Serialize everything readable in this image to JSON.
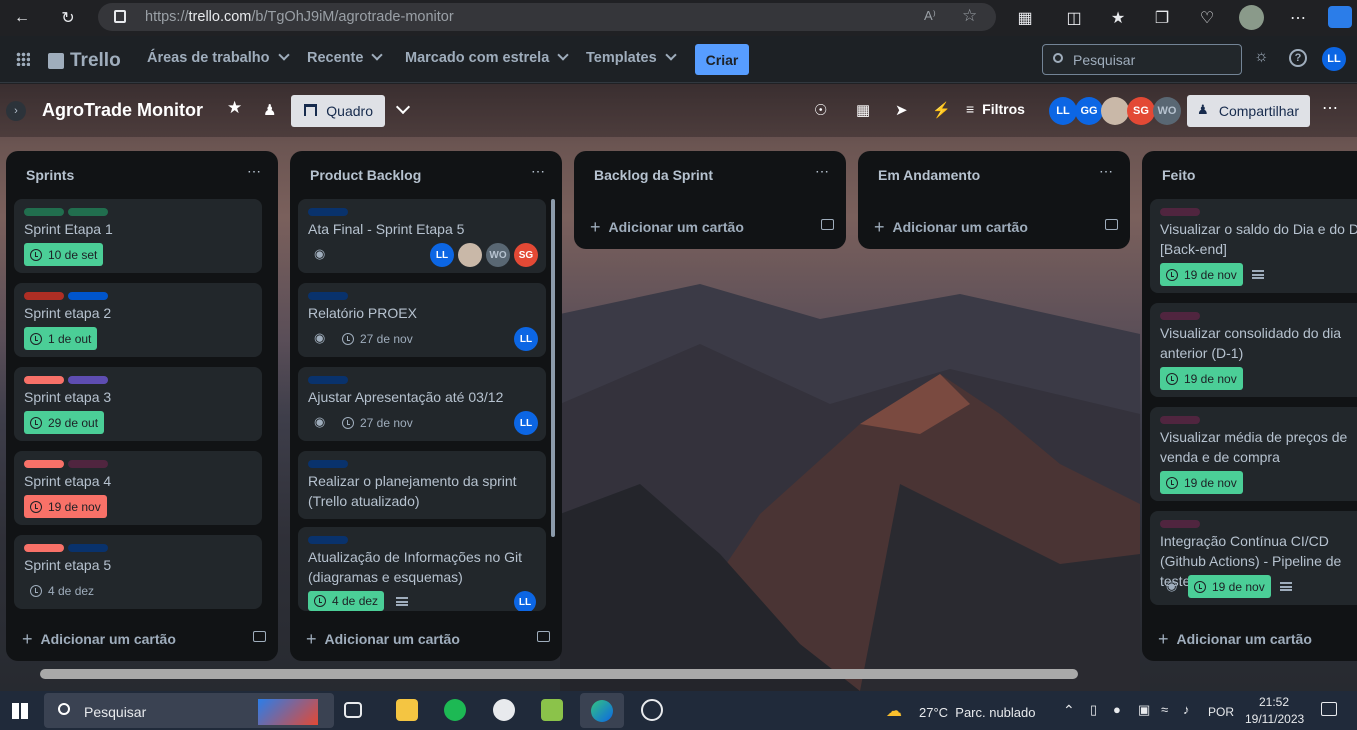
{
  "browser": {
    "url_prefix": "https://",
    "url_domain": "trello.com",
    "url_path": "/b/TgOhJ9iM/agrotrade-monitor"
  },
  "topnav": {
    "logo": "Trello",
    "items": [
      "Áreas de trabalho",
      "Recente",
      "Marcado com estrela",
      "Templates"
    ],
    "create": "Criar",
    "search_placeholder": "Pesquisar",
    "user": "LL"
  },
  "board": {
    "title": "AgroTrade Monitor",
    "view": "Quadro",
    "filters": "Filtros",
    "share": "Compartilhar",
    "members": [
      "LL",
      "GG",
      "SG",
      "WO"
    ]
  },
  "lists": [
    {
      "title": "Sprints",
      "add": "Adicionar um cartão",
      "cards": [
        {
          "title": "Sprint Etapa 1",
          "labels": [
            "#216e4e",
            "#216e4e"
          ],
          "due": "10 de set",
          "due_status": "done"
        },
        {
          "title": "Sprint etapa 2",
          "labels": [
            "#ae2e24",
            "#0055cc"
          ],
          "due": "1 de out",
          "due_status": "done"
        },
        {
          "title": "Sprint etapa 3",
          "labels": [
            "#f87168",
            "#5e4db2"
          ],
          "due": "29 de out",
          "due_status": "done"
        },
        {
          "title": "Sprint etapa 4",
          "labels": [
            "#f87168",
            "#50253f"
          ],
          "due": "19 de nov",
          "due_status": "overdue"
        },
        {
          "title": "Sprint etapa 5",
          "labels": [
            "#f87168",
            "#09326c"
          ],
          "due": "4 de dez",
          "due_status": "none"
        }
      ]
    },
    {
      "title": "Product Backlog",
      "add": "Adicionar um cartão",
      "cards": [
        {
          "title": "Ata Final - Sprint Etapa 5",
          "members": [
            "LL",
            "",
            "WO",
            "SG"
          ]
        },
        {
          "title": "Relatório PROEX",
          "due": "27 de nov",
          "members": [
            "LL"
          ]
        },
        {
          "title": "Ajustar Apresentação até 03/12",
          "due": "27 de nov",
          "members": [
            "LL"
          ]
        },
        {
          "title": "Realizar o planejamento da sprint (Trello atualizado)"
        },
        {
          "title": "Atualização de Informações no Git (diagramas e esquemas)",
          "due": "4 de dez",
          "members": [
            "LL"
          ]
        }
      ]
    },
    {
      "title": "Backlog da Sprint",
      "add": "Adicionar um cartão",
      "cards": []
    },
    {
      "title": "Em Andamento",
      "add": "Adicionar um cartão",
      "cards": []
    },
    {
      "title": "Feito",
      "add": "Adicionar um cartão",
      "cards": [
        {
          "title": "Visualizar o saldo do Dia e do Dia [Back-end]",
          "due": "19 de nov"
        },
        {
          "title": "Visualizar consolidado do dia anterior (D-1)",
          "due": "19 de nov"
        },
        {
          "title": "Visualizar média de preços de venda e de compra",
          "due": "19 de nov"
        },
        {
          "title": "Integração Contínua CI/CD (Github Actions) - Pipeline de testes",
          "due": "19 de nov"
        }
      ]
    }
  ],
  "taskbar": {
    "search": "Pesquisar",
    "weather": "27°C  Parc. nublado",
    "lang": "POR",
    "time": "21:52",
    "date": "19/11/2023"
  }
}
